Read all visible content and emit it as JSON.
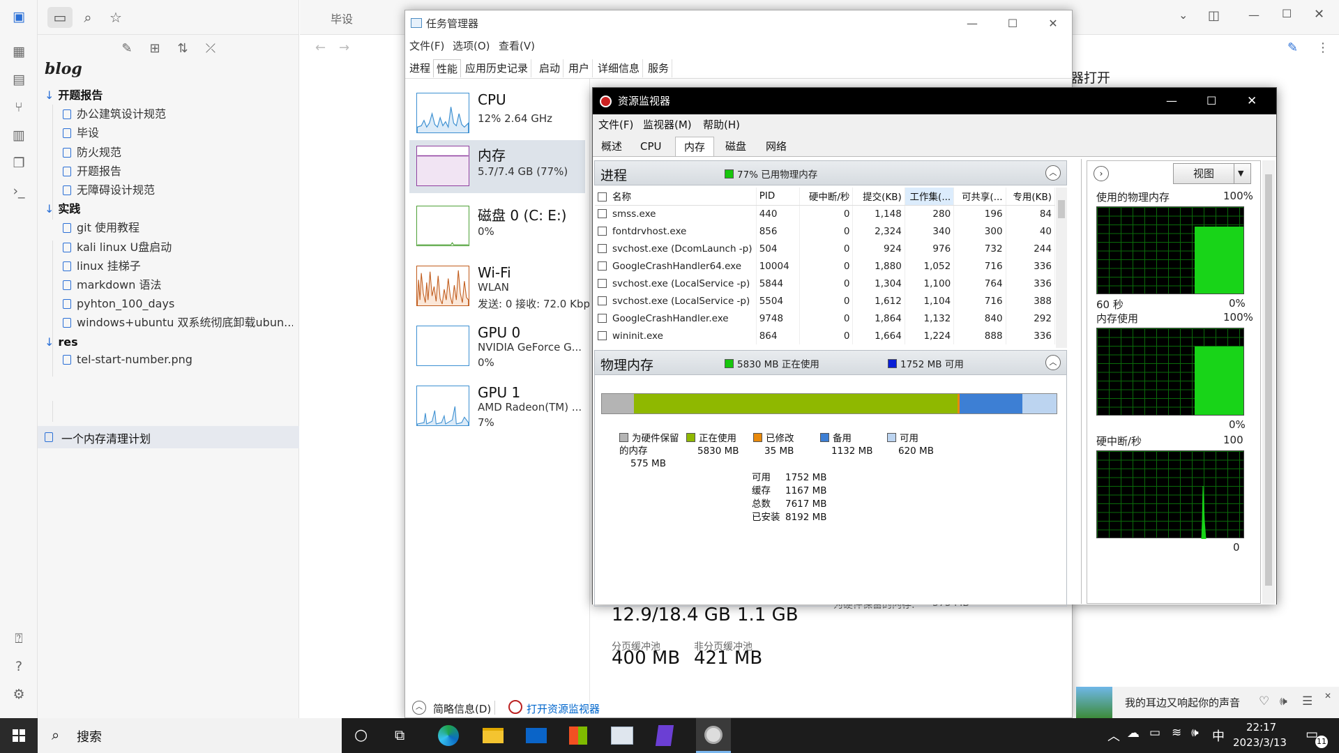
{
  "obsidian": {
    "vault": "blog",
    "tab_title": "毕设",
    "editor_snippet": "器打开",
    "tree": [
      {
        "kind": "folder",
        "label": "开题报告"
      },
      {
        "kind": "file",
        "label": "办公建筑设计规范"
      },
      {
        "kind": "file",
        "label": "毕设"
      },
      {
        "kind": "file",
        "label": "防火规范"
      },
      {
        "kind": "file",
        "label": "开题报告"
      },
      {
        "kind": "file",
        "label": "无障碍设计规范"
      },
      {
        "kind": "folder",
        "label": "实践"
      },
      {
        "kind": "file",
        "label": "git 使用教程"
      },
      {
        "kind": "file",
        "label": "kali linux U盘启动"
      },
      {
        "kind": "file",
        "label": "linux 挂梯子"
      },
      {
        "kind": "file",
        "label": "markdown 语法"
      },
      {
        "kind": "file",
        "label": "pyhton_100_days"
      },
      {
        "kind": "file",
        "label": "windows+ubuntu 双系统彻底卸载ubun..."
      },
      {
        "kind": "folder",
        "label": "res"
      },
      {
        "kind": "file",
        "label": "tel-start-number.png"
      }
    ],
    "active_file": "一个内存清理计划"
  },
  "taskmgr": {
    "title": "任务管理器",
    "menu": [
      "文件(F)",
      "选项(O)",
      "查看(V)"
    ],
    "tabs": [
      "进程",
      "性能",
      "应用历史记录",
      "启动",
      "用户",
      "详细信息",
      "服务"
    ],
    "perf": [
      {
        "name": "CPU",
        "sub1": "12% 2.64 GHz",
        "sub2": ""
      },
      {
        "name": "内存",
        "sub1": "5.7/7.4 GB (77%)",
        "sub2": ""
      },
      {
        "name": "磁盘 0 (C: E:)",
        "sub1": "0%",
        "sub2": ""
      },
      {
        "name": "Wi-Fi",
        "sub1": "WLAN",
        "sub2": "发送: 0 接收: 72.0 Kbp"
      },
      {
        "name": "GPU 0",
        "sub1": "NVIDIA GeForce G...",
        "sub2": "0%"
      },
      {
        "name": "GPU 1",
        "sub1": "AMD Radeon(TM) ...",
        "sub2": "7%"
      }
    ],
    "committed": "12.9/18.4 GB",
    "cached": "1.1 GB",
    "paged_label": "分页缓冲池",
    "paged": "400 MB",
    "nonpaged_label": "非分页缓冲池",
    "nonpaged": "421 MB",
    "hw_reserved_partial": "为硬件保留的内存:",
    "hw_reserved_partial_val": "575 MB",
    "fewer_details": "简略信息(D)",
    "open_resmon": "打开资源监视器"
  },
  "resmon": {
    "title": "资源监视器",
    "menu": [
      "文件(F)",
      "监视器(M)",
      "帮助(H)"
    ],
    "tabs": [
      "概述",
      "CPU",
      "内存",
      "磁盘",
      "网络"
    ],
    "proc_header": "进程",
    "proc_badge": "77% 已用物理内存",
    "columns": [
      "名称",
      "PID",
      "硬中断/秒",
      "提交(KB)",
      "工作集(...",
      "可共享(...",
      "专用(KB)"
    ],
    "rows": [
      [
        "smss.exe",
        "440",
        "0",
        "1,148",
        "280",
        "196",
        "84"
      ],
      [
        "fontdrvhost.exe",
        "856",
        "0",
        "2,324",
        "340",
        "300",
        "40"
      ],
      [
        "svchost.exe (DcomLaunch -p)",
        "504",
        "0",
        "924",
        "976",
        "732",
        "244"
      ],
      [
        "GoogleCrashHandler64.exe",
        "10004",
        "0",
        "1,880",
        "1,052",
        "716",
        "336"
      ],
      [
        "svchost.exe (LocalService -p)",
        "5844",
        "0",
        "1,304",
        "1,100",
        "764",
        "336"
      ],
      [
        "svchost.exe (LocalService -p)",
        "5504",
        "0",
        "1,612",
        "1,104",
        "716",
        "388"
      ],
      [
        "GoogleCrashHandler.exe",
        "9748",
        "0",
        "1,864",
        "1,132",
        "840",
        "292"
      ],
      [
        "wininit.exe",
        "864",
        "0",
        "1,664",
        "1,224",
        "888",
        "336"
      ]
    ],
    "phys_header": "物理内存",
    "phys_inuse": "5830 MB 正在使用",
    "phys_avail": "1752 MB 可用",
    "mem_bar": [
      {
        "name": "hardware",
        "mb": 575,
        "color": "#b4b4b4"
      },
      {
        "name": "inuse",
        "mb": 5830,
        "color": "#8fb800"
      },
      {
        "name": "modified",
        "mb": 35,
        "color": "#e8890c"
      },
      {
        "name": "standby",
        "mb": 1132,
        "color": "#3d7fd4"
      },
      {
        "name": "free",
        "mb": 620,
        "color": "#bcd4f0"
      }
    ],
    "legend": [
      {
        "label": "为硬件保留的内存",
        "value": "575 MB",
        "color": "#b4b4b4"
      },
      {
        "label": "正在使用",
        "value": "5830 MB",
        "color": "#8fb800"
      },
      {
        "label": "已修改",
        "value": "35 MB",
        "color": "#e8890c"
      },
      {
        "label": "备用",
        "value": "1132 MB",
        "color": "#3d7fd4"
      },
      {
        "label": "可用",
        "value": "620 MB",
        "color": "#bcd4f0"
      }
    ],
    "summary": [
      {
        "k": "可用",
        "v": "1752 MB"
      },
      {
        "k": "缓存",
        "v": "1167 MB"
      },
      {
        "k": "总数",
        "v": "7617 MB"
      },
      {
        "k": "已安装",
        "v": "8192 MB"
      }
    ],
    "view_btn": "视图",
    "g1_title": "使用的物理内存",
    "g1_max": "100%",
    "g1_foot_l": "60 秒",
    "g1_foot_r": "0%",
    "g2_title": "内存使用",
    "g2_max": "100%",
    "g2_foot_r": "0%",
    "g3_title": "硬中断/秒",
    "g3_max": "100",
    "g3_foot_r": "0"
  },
  "music": {
    "title": "我的耳边又响起你的声音"
  },
  "taskbar": {
    "search": "搜索",
    "time": "22:17",
    "date": "2023/3/13",
    "ime": "中",
    "notif": "11"
  }
}
